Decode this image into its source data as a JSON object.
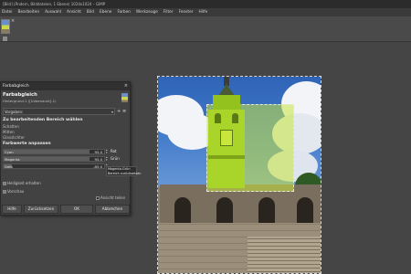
{
  "window": {
    "title": "[Bild] (Ändern, Bilddateien, 1 Ebene) 1024x1024 – GIMP"
  },
  "menubar": {
    "items": [
      "Datei",
      "Bearbeiten",
      "Auswahl",
      "Ansicht",
      "Bild",
      "Ebene",
      "Farben",
      "Werkzeuge",
      "Filter",
      "Fenster",
      "Hilfe"
    ]
  },
  "image_tab": {
    "close_glyph": "×"
  },
  "dialog": {
    "title": "Farbabgleich",
    "close_glyph": "×",
    "heading": "Farbabgleich",
    "subheading": "Hintergrund-1 ([Unbenannt]-1)",
    "presets_label": "Vorgaben:",
    "presets_add": "+",
    "presets_menu": "≡",
    "range_section": "Zu bearbeitenden Bereich wählen",
    "range_options": [
      "Schatten",
      "Mitten",
      "Glanzlichter"
    ],
    "adjust_section": "Farbwerte anpassen",
    "sliders": [
      {
        "label": "Cyan",
        "value": "95.0",
        "fraction": 0.85,
        "side": "Rot"
      },
      {
        "label": "Magenta",
        "value": "95.0",
        "fraction": 0.85,
        "side": "Grün"
      },
      {
        "label": "Gelb",
        "value": "-85.0",
        "fraction": 0.08,
        "side": "Blau"
      }
    ],
    "tooltip_line1": "Magenta-Grün",
    "tooltip_line2": "Bereich zurücksetzen",
    "preserve_label": "Helligkeit erhalten",
    "preview_label": "Vorschau",
    "split_label": "Ansicht teilen",
    "buttons": {
      "help": "Hilfe",
      "reset": "Zurücksetzen",
      "ok": "OK",
      "cancel": "Abbrechen"
    }
  },
  "colors": {
    "selection_tint": "#c8e63c",
    "dialog_bg": "#424242",
    "canvas_bg": "#454545"
  }
}
